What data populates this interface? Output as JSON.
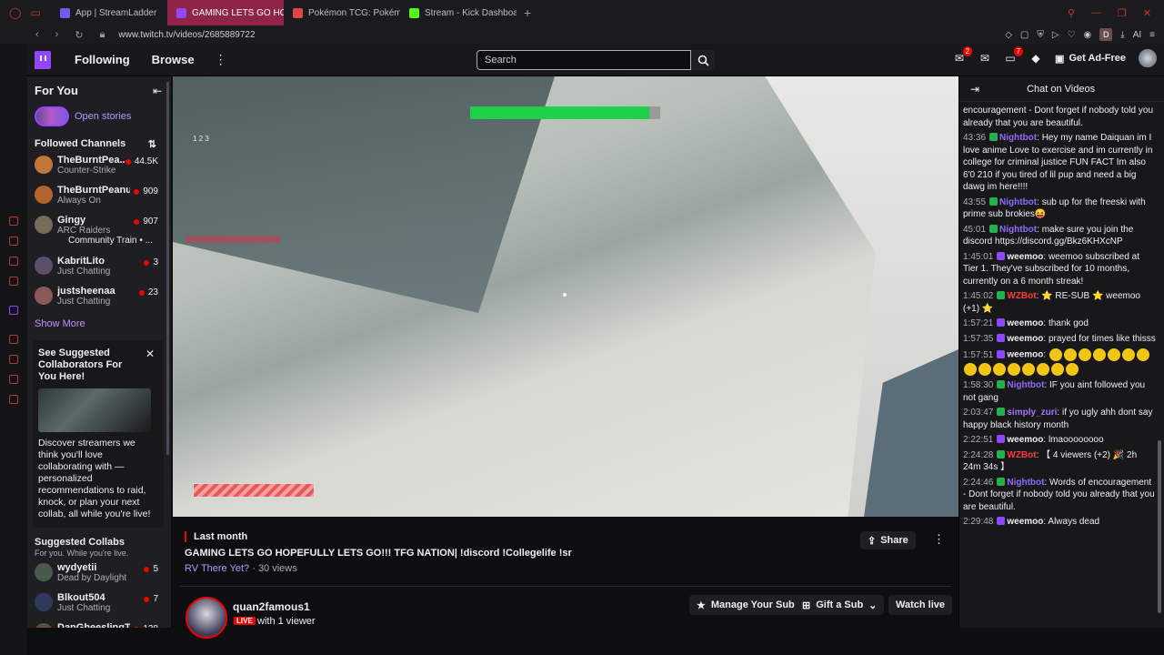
{
  "browser": {
    "tabs": [
      {
        "label": "App | StreamLadder",
        "color": "#6e5cf0"
      },
      {
        "label": "GAMING LETS GO HO",
        "color": "#9147ff",
        "active": true
      },
      {
        "label": "Pokémon TCG: Pokémon",
        "color": "#e04444"
      },
      {
        "label": "Stream - Kick Dashboard",
        "color": "#53fc18"
      }
    ],
    "url": "www.twitch.tv/videos/2685889722",
    "ext_avatar": "D",
    "ai_label": "AI"
  },
  "topnav": {
    "following": "Following",
    "browse": "Browse",
    "search_placeholder": "Search",
    "prime_badge": "2",
    "notif_badge": "7",
    "get_ad_free": "Get Ad-Free"
  },
  "sidebar": {
    "for_you": "For You",
    "open_stories": "Open stories",
    "followed_channels": "Followed Channels",
    "channels": [
      {
        "name": "TheBurntPea...",
        "game": "Counter-Strike",
        "viewers": "44.5K",
        "color": "#c2763a"
      },
      {
        "name": "TheBurntPeanu...",
        "game": "Always On",
        "viewers": "909",
        "color": "#b5632e"
      },
      {
        "name": "Gingy",
        "game": "ARC Raiders",
        "viewers": "907",
        "color": "#7a6a58",
        "extra": "Community Train • ..."
      },
      {
        "name": "KabritLito",
        "game": "Just Chatting",
        "viewers": "3",
        "color": "#5c4f6a"
      },
      {
        "name": "justsheenaa",
        "game": "Just Chatting",
        "viewers": "23",
        "color": "#8a5a5a"
      }
    ],
    "show_more": "Show More",
    "suggest_card": {
      "heading": "See Suggested Collaborators For You Here!",
      "description": "Discover streamers we think you'll love collaborating with — personalized recommendations to raid, knock, or plan your next collab, all while you're live!"
    },
    "suggested_collabs": "Suggested Collabs",
    "suggested_sub": "For you. While you're live.",
    "collabs": [
      {
        "name": "wydyetii",
        "game": "Dead by Daylight",
        "viewers": "5",
        "color": "#4a5a4a"
      },
      {
        "name": "Blkout504",
        "game": "Just Chatting",
        "viewers": "7",
        "color": "#2e3a5a"
      },
      {
        "name": "DanGheeslingTV",
        "game": "Always On",
        "viewers": "128",
        "color": "#6a4a3a"
      }
    ]
  },
  "video": {
    "last_month": "Last month",
    "title": "GAMING LETS GO HOPEFULLY LETS GO!!! TFG NATION| !discord !Collegelife !sr",
    "category": "RV There Yet?",
    "views": "· 30 views",
    "share": "Share",
    "streamer": "quan2famous1",
    "live": "LIVE",
    "viewer_count": "with 1 viewer",
    "manage_sub": "Manage Your Sub",
    "gift_sub": "Gift a Sub",
    "watch_live": "Watch live",
    "hud_numbers": "1  2  3"
  },
  "chat": {
    "header": "Chat on Videos",
    "messages": [
      {
        "ts": "",
        "user": "",
        "ucolor": "#efeff1",
        "text": "encouragement - Dont forget if nobody told you already that you are beautiful."
      },
      {
        "ts": "43:36",
        "user": "Nightbot",
        "ucolor": "#8f6bff",
        "text": "Hey my name Daiquan im I love anime Love to exercise and im currently in college for criminal justice FUN FACT Im also 6'0 210 if you tired of lil pup and need a big dawg im here!!!!"
      },
      {
        "ts": "43:55",
        "user": "Nightbot",
        "ucolor": "#8f6bff",
        "text": "sub up for the freeski with prime sub brokies😝"
      },
      {
        "ts": "45:01",
        "user": "Nightbot",
        "ucolor": "#8f6bff",
        "text": "make sure you join the discord https://discord.gg/Bkz6KHXcNP"
      },
      {
        "ts": "1:45:01",
        "user": "weemoo",
        "ucolor": "#efeff1",
        "text": "weemoo subscribed at Tier 1. They've subscribed for 10 months, currently on a 6 month streak!"
      },
      {
        "ts": "1:45:02",
        "user": "WZBot",
        "ucolor": "#ff3b3b",
        "text": "⭐ RE-SUB ⭐ weemoo (+1) ⭐"
      },
      {
        "ts": "1:57:21",
        "user": "weemoo",
        "ucolor": "#efeff1",
        "text": "thank god"
      },
      {
        "ts": "1:57:35",
        "user": "weemoo",
        "ucolor": "#efeff1",
        "text": "prayed for times like thisss"
      },
      {
        "ts": "1:57:51",
        "user": "weemoo",
        "ucolor": "#efeff1",
        "text": "",
        "emotes": 15
      },
      {
        "ts": "1:58:30",
        "user": "Nightbot",
        "ucolor": "#8f6bff",
        "text": "IF you aint followed you not gang"
      },
      {
        "ts": "2:03:47",
        "user": "simply_zuri",
        "ucolor": "#a970ff",
        "text": "if yo ugly ahh dont say happy black history month"
      },
      {
        "ts": "2:22:51",
        "user": "weemoo",
        "ucolor": "#efeff1",
        "text": "lmaoooooooo"
      },
      {
        "ts": "2:24:28",
        "user": "WZBot",
        "ucolor": "#ff3b3b",
        "text": "【 4 viewers (+2) 🎉 2h 24m 34s 】"
      },
      {
        "ts": "2:24:46",
        "user": "Nightbot",
        "ucolor": "#8f6bff",
        "text": "Words of encouragement - Dont forget if nobody told you already that you are beautiful."
      },
      {
        "ts": "2:29:48",
        "user": "weemoo",
        "ucolor": "#efeff1",
        "text": "Always dead"
      }
    ]
  }
}
